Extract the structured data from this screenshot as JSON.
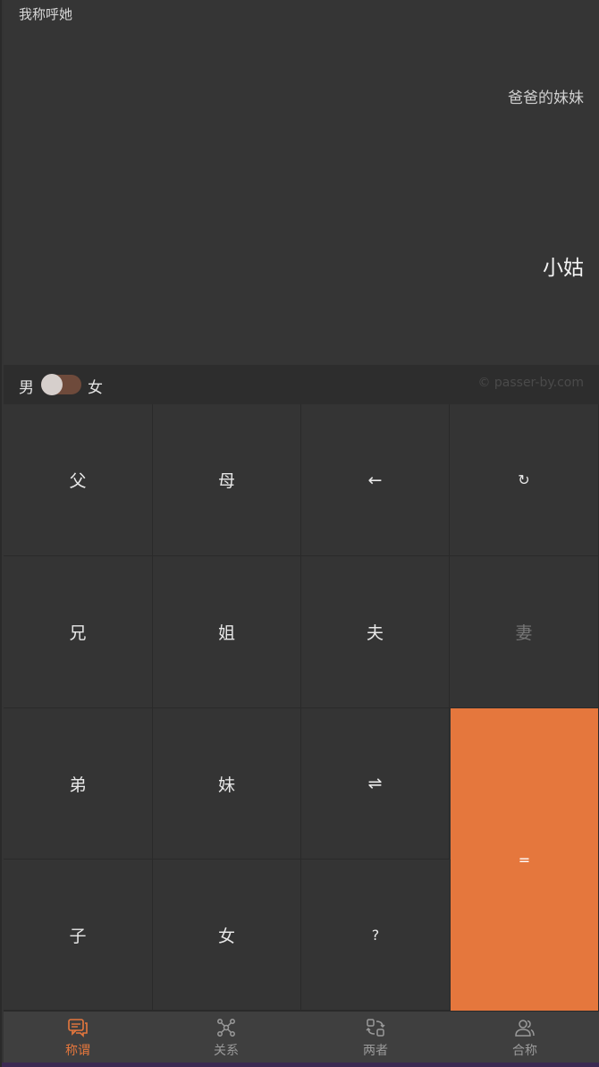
{
  "display": {
    "header": "我称呼她",
    "expression": "爸爸的妹妹",
    "result": "小姑"
  },
  "options": {
    "male_label": "男",
    "female_label": "女",
    "toggle_state": "female",
    "copyright": "© passer-by.com"
  },
  "keys": {
    "father": "父",
    "mother": "母",
    "backspace": "←",
    "reset": "↻",
    "older_brother": "兄",
    "older_sister": "姐",
    "husband": "夫",
    "wife": "妻",
    "younger_brother": "弟",
    "younger_sister": "妹",
    "swap": "⇌",
    "equals": "=",
    "son": "子",
    "daughter": "女",
    "question": "?"
  },
  "nav": {
    "items": [
      {
        "label": "称谓",
        "icon": "chat-bubbles-icon",
        "active": true
      },
      {
        "label": "关系",
        "icon": "network-icon",
        "active": false
      },
      {
        "label": "两者",
        "icon": "exchange-icon",
        "active": false
      },
      {
        "label": "合称",
        "icon": "users-icon",
        "active": false
      }
    ]
  },
  "colors": {
    "accent": "#e5773d",
    "background": "#343434",
    "toggle_track": "#6e4a3b"
  }
}
